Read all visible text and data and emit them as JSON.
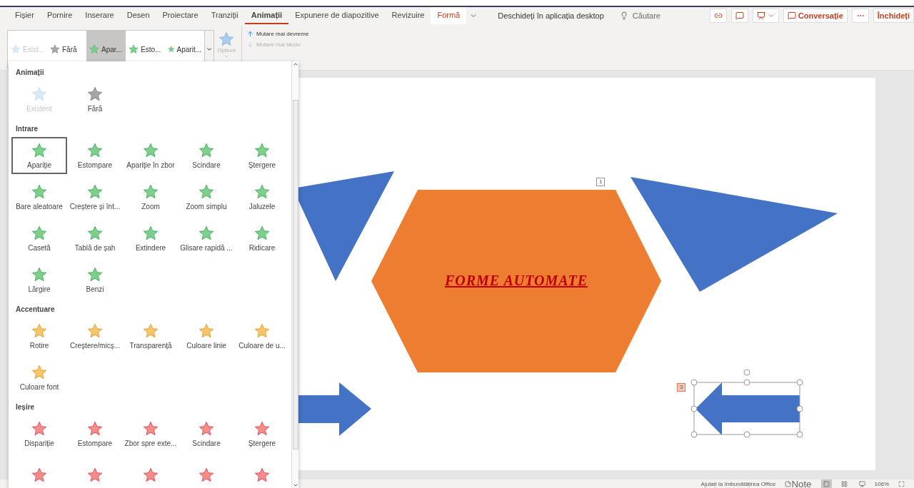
{
  "tabs": [
    {
      "label": "Fișier",
      "selected": false,
      "kind": "normal"
    },
    {
      "label": "Pornire",
      "selected": false,
      "kind": "normal"
    },
    {
      "label": "Inserare",
      "selected": false,
      "kind": "normal"
    },
    {
      "label": "Desen",
      "selected": false,
      "kind": "normal"
    },
    {
      "label": "Proiectare",
      "selected": false,
      "kind": "normal"
    },
    {
      "label": "Tranziții",
      "selected": false,
      "kind": "normal"
    },
    {
      "label": "Animații",
      "selected": true,
      "kind": "normal"
    },
    {
      "label": "Expunere de diapozitive",
      "selected": false,
      "kind": "normal"
    },
    {
      "label": "Revizuire",
      "selected": false,
      "kind": "normal"
    },
    {
      "label": "Formă",
      "selected": false,
      "kind": "contextual"
    }
  ],
  "open_desktop": "Deschideți în aplicația desktop",
  "search": {
    "placeholder": "Căutare"
  },
  "header_buttons": {
    "conversation": "Conversație",
    "close": "Închideți"
  },
  "ribbon": {
    "gallery": [
      {
        "label": "Exist...",
        "kind": "existing",
        "selected": false,
        "disabled": true
      },
      {
        "label": "Fără",
        "kind": "none",
        "selected": false,
        "disabled": false
      },
      {
        "label": "Apar...",
        "kind": "entrance",
        "selected": true,
        "disabled": false
      },
      {
        "label": "Esto...",
        "kind": "entrance",
        "selected": false,
        "disabled": false
      },
      {
        "label": "Aparit...",
        "kind": "entrance",
        "selected": false,
        "disabled": false
      }
    ],
    "options": {
      "label": "Opțiuni",
      "disabled": true
    },
    "move": [
      {
        "label": "Mutare mai devreme",
        "kind": "up",
        "disabled": false
      },
      {
        "label": "Mutare mai târziu",
        "kind": "down",
        "disabled": true
      }
    ]
  },
  "animation_panel": {
    "groups": [
      {
        "title": "Animații",
        "items": [
          {
            "label": "Existent",
            "kind": "existing",
            "selected": false,
            "disabled": true
          },
          {
            "label": "Fără",
            "kind": "none",
            "selected": false,
            "disabled": false
          }
        ]
      },
      {
        "title": "Intrare",
        "items": [
          {
            "label": "Apariție",
            "kind": "entrance",
            "selected": true,
            "disabled": false
          },
          {
            "label": "Estompare",
            "kind": "entrance",
            "selected": false,
            "disabled": false
          },
          {
            "label": "Apariție în zbor",
            "kind": "entrance",
            "selected": false,
            "disabled": false
          },
          {
            "label": "Scindare",
            "kind": "entrance",
            "selected": false,
            "disabled": false
          },
          {
            "label": "Ștergere",
            "kind": "entrance",
            "selected": false,
            "disabled": false
          },
          {
            "label": "Bare aleatoare",
            "kind": "entrance",
            "selected": false,
            "disabled": false
          },
          {
            "label": "Creștere și înt...",
            "kind": "entrance",
            "selected": false,
            "disabled": false
          },
          {
            "label": "Zoom",
            "kind": "entrance",
            "selected": false,
            "disabled": false
          },
          {
            "label": "Zoom simplu",
            "kind": "entrance",
            "selected": false,
            "disabled": false
          },
          {
            "label": "Jaluzele",
            "kind": "entrance",
            "selected": false,
            "disabled": false
          },
          {
            "label": "Casetă",
            "kind": "entrance",
            "selected": false,
            "disabled": false
          },
          {
            "label": "Tablă de șah",
            "kind": "entrance",
            "selected": false,
            "disabled": false
          },
          {
            "label": "Extindere",
            "kind": "entrance",
            "selected": false,
            "disabled": false
          },
          {
            "label": "Glisare rapidă ...",
            "kind": "entrance",
            "selected": false,
            "disabled": false
          },
          {
            "label": "Ridicare",
            "kind": "entrance",
            "selected": false,
            "disabled": false
          },
          {
            "label": "Lărgire",
            "kind": "entrance",
            "selected": false,
            "disabled": false
          },
          {
            "label": "Benzi",
            "kind": "entrance",
            "selected": false,
            "disabled": false
          }
        ]
      },
      {
        "title": "Accentuare",
        "items": [
          {
            "label": "Rotire",
            "kind": "emphasis",
            "selected": false,
            "disabled": false
          },
          {
            "label": "Creștere/micș...",
            "kind": "emphasis",
            "selected": false,
            "disabled": false
          },
          {
            "label": "Transparență",
            "kind": "emphasis",
            "selected": false,
            "disabled": false
          },
          {
            "label": "Culoare linie",
            "kind": "emphasis",
            "selected": false,
            "disabled": false
          },
          {
            "label": "Culoare de u...",
            "kind": "emphasis",
            "selected": false,
            "disabled": false
          },
          {
            "label": "Culoare font",
            "kind": "emphasis",
            "selected": false,
            "disabled": false
          }
        ]
      },
      {
        "title": "Ieșire",
        "items": [
          {
            "label": "Dispariție",
            "kind": "exit",
            "selected": false,
            "disabled": false
          },
          {
            "label": "Estompare",
            "kind": "exit",
            "selected": false,
            "disabled": false
          },
          {
            "label": "Zbor spre exte...",
            "kind": "exit",
            "selected": false,
            "disabled": false
          },
          {
            "label": "Scindare",
            "kind": "exit",
            "selected": false,
            "disabled": false
          },
          {
            "label": "Ștergere",
            "kind": "exit",
            "selected": false,
            "disabled": false
          },
          {
            "kind": "exit",
            "selected": false,
            "disabled": false
          },
          {
            "kind": "exit",
            "selected": false,
            "disabled": false
          },
          {
            "kind": "exit",
            "selected": false,
            "disabled": false
          },
          {
            "kind": "exit",
            "selected": false,
            "disabled": false
          },
          {
            "kind": "exit",
            "selected": false,
            "disabled": false
          }
        ]
      }
    ]
  },
  "slide": {
    "title": "FORME AUTOMATE",
    "badges": [
      {
        "label": "1",
        "selected": false
      },
      {
        "label": "3",
        "selected": true
      }
    ]
  },
  "status_bar": {
    "help": "Ajutați la îmbunătățirea Office",
    "notes": "Note",
    "zoom": "106%"
  }
}
